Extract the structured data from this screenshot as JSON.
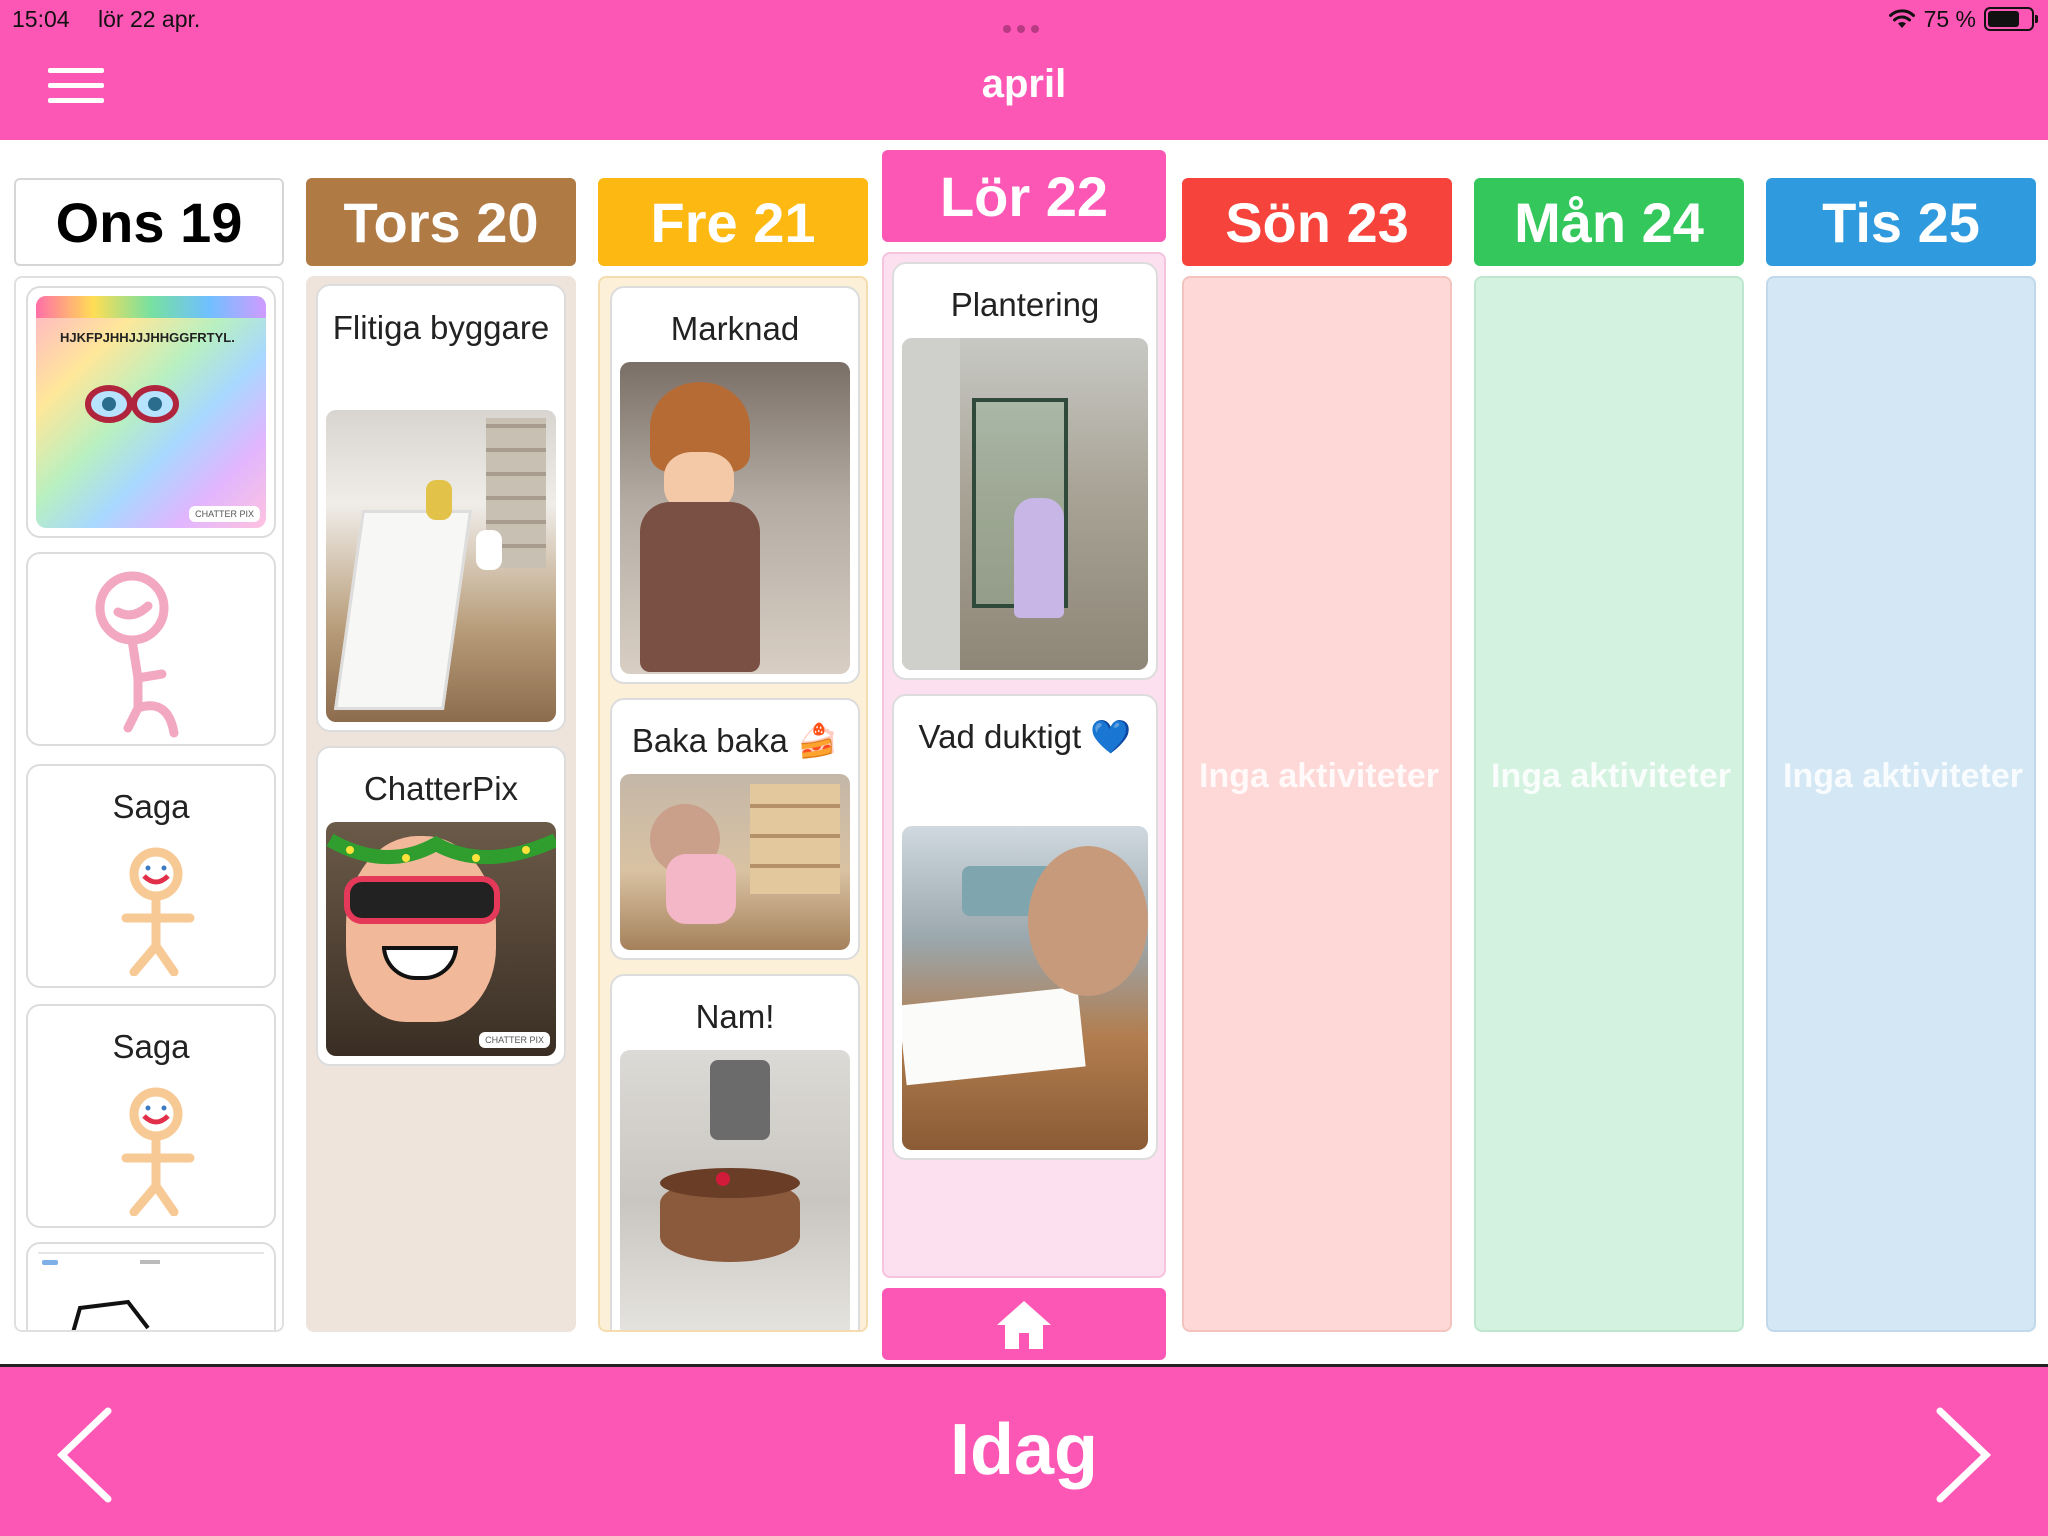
{
  "status": {
    "time": "15:04",
    "date": "lör 22 apr.",
    "battery": "75 %",
    "battery_level": 0.75
  },
  "header": {
    "title": "april"
  },
  "days": [
    {
      "label": "Ons 19",
      "color": "#ffffff",
      "text_color": "#000000"
    },
    {
      "label": "Tors 20",
      "color": "#b07a45",
      "body": "#eee4dc"
    },
    {
      "label": "Fre 21",
      "color": "#fdb912",
      "body": "#fdf0d8"
    },
    {
      "label": "Lör 22",
      "color": "#fd57b6",
      "body": "#fde0f0"
    },
    {
      "label": "Sön 23",
      "color": "#f6443c",
      "body": "#fdd8d6",
      "empty": "Inga aktiviteter"
    },
    {
      "label": "Mån 24",
      "color": "#34c85c",
      "body": "#d4f2e0",
      "empty": "Inga aktiviteter"
    },
    {
      "label": "Tis 25",
      "color": "#2f9bde",
      "body": "#d4e7f4",
      "empty": "Inga aktiviteter"
    }
  ],
  "activities": {
    "ons19": {
      "saga1": "Saga",
      "saga2": "Saga",
      "chatter_text": "HJKFPJHHJJJHHGGFRTYL.",
      "chatterpix_badge": "CHATTER PIX"
    },
    "tors20": {
      "card1": "Flitiga byggare",
      "card2": "ChatterPix",
      "chatterpix_badge": "CHATTER PIX"
    },
    "fre21": {
      "card1": "Marknad",
      "card2": "Baka baka 🍰",
      "card3": "Nam!"
    },
    "lor22": {
      "card1": "Plantering",
      "card2": "Vad duktigt 💙"
    }
  },
  "footer": {
    "today_label": "Idag"
  },
  "icons": {
    "menu": "hamburger-icon",
    "home": "home-icon",
    "prev": "chevron-left-icon",
    "next": "chevron-right-icon"
  }
}
